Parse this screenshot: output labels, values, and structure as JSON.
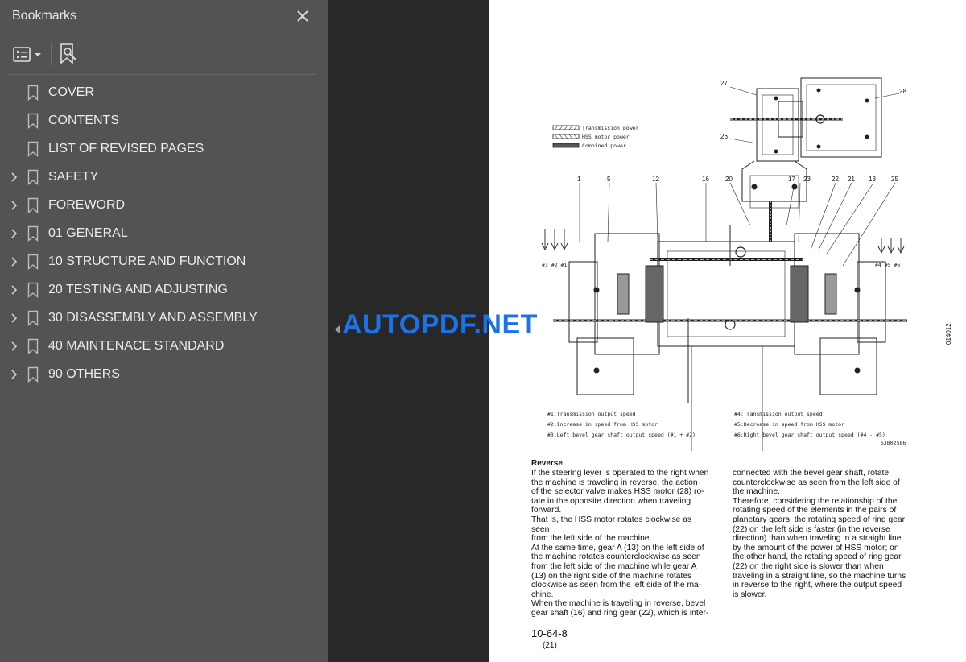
{
  "panel": {
    "title": "Bookmarks",
    "items": [
      {
        "label": "COVER",
        "expandable": false
      },
      {
        "label": "CONTENTS",
        "expandable": false
      },
      {
        "label": "LIST OF REVISED PAGES",
        "expandable": false
      },
      {
        "label": "SAFETY",
        "expandable": true
      },
      {
        "label": "FOREWORD",
        "expandable": true
      },
      {
        "label": "01 GENERAL",
        "expandable": true
      },
      {
        "label": "10 STRUCTURE AND FUNCTION",
        "expandable": true
      },
      {
        "label": "20 TESTING AND ADJUSTING",
        "expandable": true
      },
      {
        "label": "30 DISASSEMBLY AND ASSEMBLY",
        "expandable": true
      },
      {
        "label": "40 MAINTENACE STANDARD",
        "expandable": true
      },
      {
        "label": "90 OTHERS",
        "expandable": true
      }
    ]
  },
  "watermark": "AUTOPDF.NET",
  "document": {
    "legend": [
      "Transmission power",
      "HSS motor power",
      "Combined power"
    ],
    "callouts": [
      "27",
      "28",
      "26",
      "1",
      "5",
      "12",
      "16",
      "20",
      "17",
      "23",
      "22",
      "21",
      "13",
      "25"
    ],
    "arrow_labels_left": "#3 #2 #1",
    "arrow_labels_right": "#4 #5 #6",
    "figure_id": "014012",
    "notes_left": [
      "#1:Transmission output speed",
      "#2:Increase in speed from HSS motor",
      "#3:Left bevel gear shaft output speed (#1 + #2)"
    ],
    "notes_right": [
      "#4:Transmission output speed",
      "#5:Decrease in speed from HSS motor",
      "#6:Right bevel gear shaft output speed (#4 - #5)"
    ],
    "drawing_code": "SJB02586",
    "heading": "Reverse",
    "col_left": [
      "If the steering lever is operated to the right when",
      "the machine is traveling in reverse, the action",
      "of the selector valve makes HSS motor (28) ro-",
      "tate in the opposite direction when traveling",
      "forward.",
      "That is, the HSS motor rotates clockwise as seen",
      "from the left side of the machine.",
      "At the same time, gear A (13) on the left side of",
      "the machine rotates counterclockwise as seen",
      "from the left side of the machine while gear A",
      "(13) on the right side of the machine rotates",
      "clockwise as seen from the left side of the ma-",
      "chine.",
      "When the machine is traveling in reverse, bevel",
      "gear shaft (16) and ring gear (22), which is inter-"
    ],
    "col_right": [
      "connected with the bevel gear shaft, rotate",
      "counterclockwise as seen from the left side of",
      "the machine.",
      "Therefore, considering the relationship of the",
      "rotating speed of the elements in the pairs of",
      "planetary gears, the rotating speed of ring gear",
      "(22) on the left side is faster (in the reverse",
      "direction)  than when traveling in a straight line",
      "by the amount of the power of HSS motor; on",
      "the other hand, the rotating speed of ring gear",
      "(22) on the right side is slower than when",
      "traveling in a straight line, so the machine turns",
      "in reverse to the right, where the output speed",
      "is slower."
    ],
    "page_number": "10-64-8",
    "page_sub": "(21)"
  }
}
